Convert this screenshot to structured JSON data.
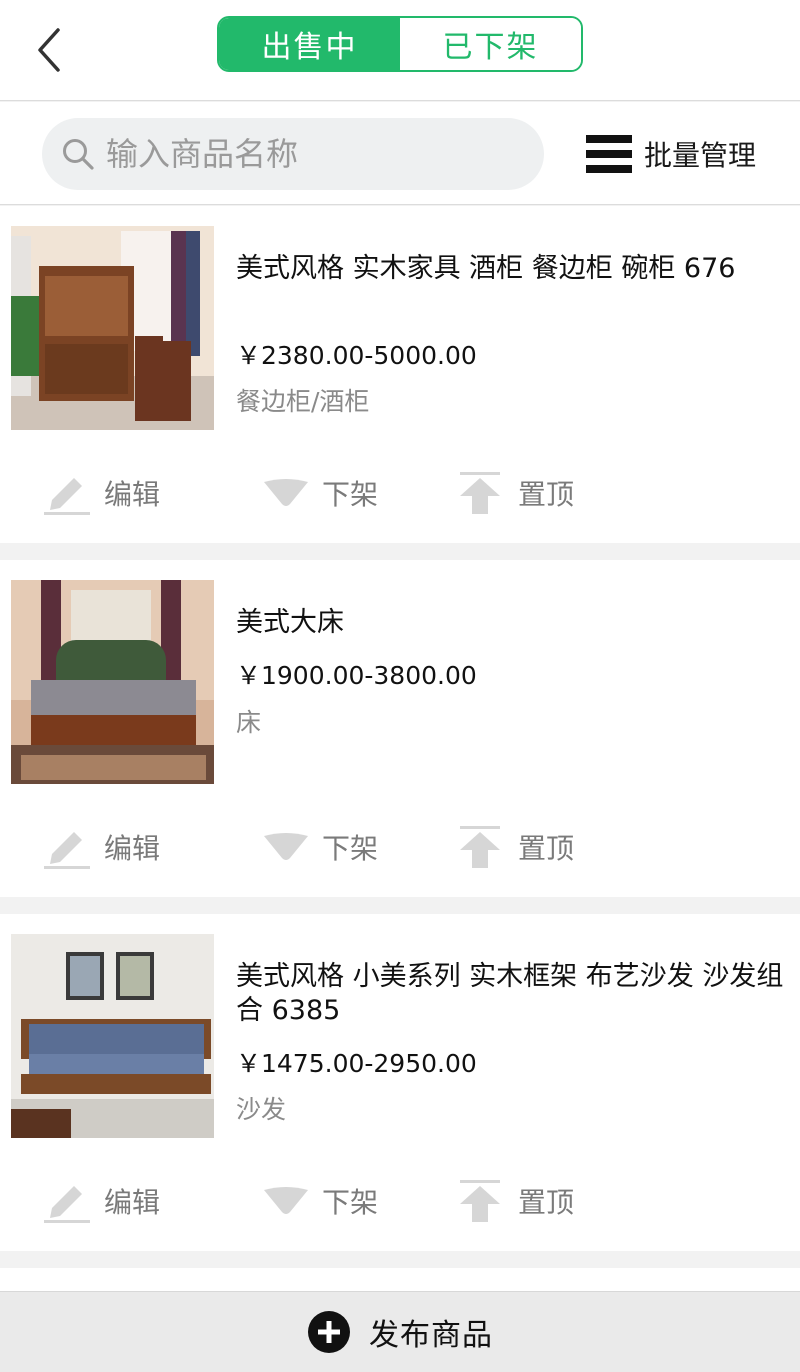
{
  "header": {
    "tabs": [
      {
        "label": "出售中",
        "active": true
      },
      {
        "label": "已下架",
        "active": false
      }
    ],
    "accent_color": "#22b96b"
  },
  "search": {
    "placeholder": "输入商品名称",
    "value": ""
  },
  "batch": {
    "label": "批量管理",
    "icon": "menu-icon"
  },
  "products": [
    {
      "title": "美式风格  实木家具   酒柜  餐边柜  碗柜 676",
      "price": "￥2380.00-5000.00",
      "category": "餐边柜/酒柜",
      "image": "sideboard-cabinet-photo",
      "actions": {
        "edit": "编辑",
        "delist": "下架",
        "pin": "置顶"
      }
    },
    {
      "title": "美式大床",
      "price": "￥1900.00-3800.00",
      "category": "床",
      "image": "bed-photo",
      "actions": {
        "edit": "编辑",
        "delist": "下架",
        "pin": "置顶"
      }
    },
    {
      "title": "美式风格 小美系列  实木框架  布艺沙发 沙发组合 6385",
      "price": "￥1475.00-2950.00",
      "category": "沙发",
      "image": "sofa-photo",
      "actions": {
        "edit": "编辑",
        "delist": "下架",
        "pin": "置顶"
      }
    }
  ],
  "footer": {
    "label": "发布商品",
    "icon": "plus-circle-icon"
  }
}
